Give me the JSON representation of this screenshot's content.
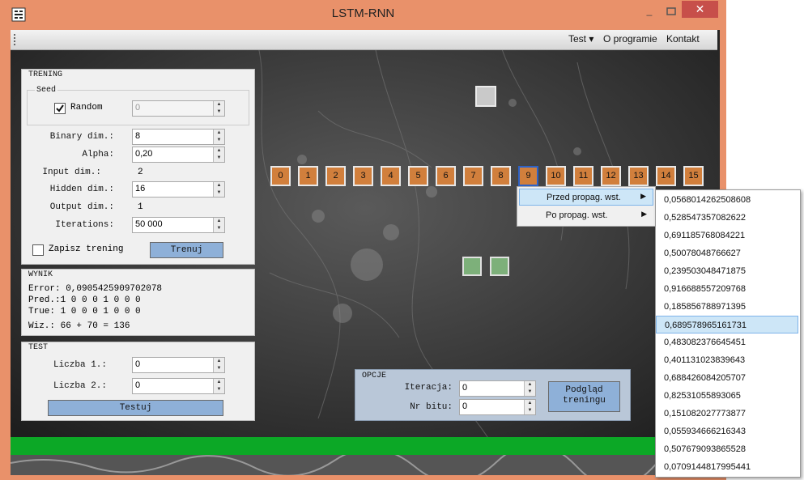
{
  "window": {
    "title": "LSTM-RNN",
    "close_glyph": "✕",
    "min_glyph": "_"
  },
  "menu": {
    "items": [
      "Test ▾",
      "O programie",
      "Kontakt"
    ]
  },
  "trening": {
    "title": "TRENING",
    "seed": {
      "title": "Seed",
      "random_label": "Random",
      "random_checked": true,
      "value": "0"
    },
    "binary_dim": {
      "label": "Binary dim.:",
      "value": "8"
    },
    "alpha": {
      "label": "Alpha:",
      "value": "0,20"
    },
    "input_dim": {
      "label": "Input dim.:",
      "value": "2"
    },
    "hidden_dim": {
      "label": "Hidden dim.:",
      "value": "16"
    },
    "output_dim": {
      "label": "Output dim.:",
      "value": "1"
    },
    "iterations": {
      "label": "Iterations:",
      "value": "50 000"
    },
    "save_label": "Zapisz trening",
    "train_button": "Trenuj"
  },
  "wynik": {
    "title": "WYNIK",
    "error": "Error: 0,0905425909702078",
    "pred": "Pred.:1 0 0 0 1 0 0 0",
    "true": "True:  1 0 0 0 1 0 0 0",
    "wiz": "Wiz.:  66 + 70 = 136"
  },
  "test": {
    "title": "TEST",
    "liczba1": {
      "label": "Liczba 1.:",
      "value": "0"
    },
    "liczba2": {
      "label": "Liczba 2.:",
      "value": "0"
    },
    "button": "Testuj"
  },
  "opcje": {
    "title": "OPCJE",
    "iteracja": {
      "label": "Iteracja:",
      "value": "0"
    },
    "nr_bitu": {
      "label": "Nr bitu:",
      "value": "0"
    },
    "preview_button_line1": "Podgląd",
    "preview_button_line2": "treningu"
  },
  "bits": [
    "0",
    "1",
    "2",
    "3",
    "4",
    "5",
    "6",
    "7",
    "8",
    "9",
    "10",
    "11",
    "12",
    "13",
    "14",
    "15"
  ],
  "selected_bit": "9",
  "context_menu": {
    "items": [
      "Przed propag. wst.",
      "Po propag. wst."
    ],
    "highlighted": "Przed propag. wst."
  },
  "submenu_values": [
    "0,0568014262508608",
    "0,528547357082622",
    "0,691185768084221",
    "0,50078048766627",
    "0,239503048471875",
    "0,916688557209768",
    "0,185856788971395",
    "0,689578965161731",
    "0,483082376645451",
    "0,401131023839643",
    "0,688426084205707",
    "0,82531055893065",
    "0,151082027773877",
    "0,055934666216343",
    "0,507679093865528",
    "0,0709144817995441"
  ],
  "highlighted_value": "0,689578965161731",
  "colors": {
    "bit": "#d17f3c",
    "progress": "#0ca826",
    "accent": "#8eb0d8"
  },
  "progress": {
    "fraction": 1.0
  }
}
